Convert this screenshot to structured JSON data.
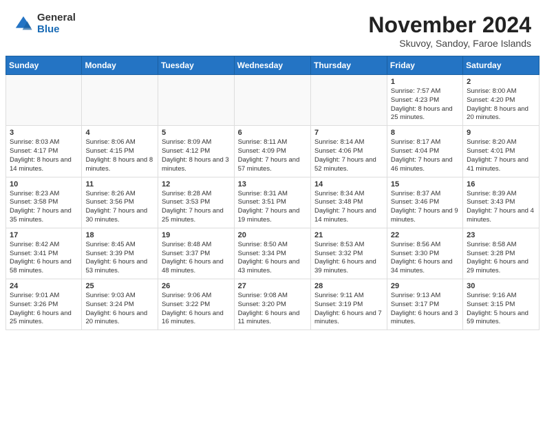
{
  "header": {
    "logo_general": "General",
    "logo_blue": "Blue",
    "month_title": "November 2024",
    "subtitle": "Skuvoy, Sandoy, Faroe Islands"
  },
  "weekdays": [
    "Sunday",
    "Monday",
    "Tuesday",
    "Wednesday",
    "Thursday",
    "Friday",
    "Saturday"
  ],
  "weeks": [
    [
      {
        "day": "",
        "info": ""
      },
      {
        "day": "",
        "info": ""
      },
      {
        "day": "",
        "info": ""
      },
      {
        "day": "",
        "info": ""
      },
      {
        "day": "",
        "info": ""
      },
      {
        "day": "1",
        "info": "Sunrise: 7:57 AM\nSunset: 4:23 PM\nDaylight: 8 hours and 25 minutes."
      },
      {
        "day": "2",
        "info": "Sunrise: 8:00 AM\nSunset: 4:20 PM\nDaylight: 8 hours and 20 minutes."
      }
    ],
    [
      {
        "day": "3",
        "info": "Sunrise: 8:03 AM\nSunset: 4:17 PM\nDaylight: 8 hours and 14 minutes."
      },
      {
        "day": "4",
        "info": "Sunrise: 8:06 AM\nSunset: 4:15 PM\nDaylight: 8 hours and 8 minutes."
      },
      {
        "day": "5",
        "info": "Sunrise: 8:09 AM\nSunset: 4:12 PM\nDaylight: 8 hours and 3 minutes."
      },
      {
        "day": "6",
        "info": "Sunrise: 8:11 AM\nSunset: 4:09 PM\nDaylight: 7 hours and 57 minutes."
      },
      {
        "day": "7",
        "info": "Sunrise: 8:14 AM\nSunset: 4:06 PM\nDaylight: 7 hours and 52 minutes."
      },
      {
        "day": "8",
        "info": "Sunrise: 8:17 AM\nSunset: 4:04 PM\nDaylight: 7 hours and 46 minutes."
      },
      {
        "day": "9",
        "info": "Sunrise: 8:20 AM\nSunset: 4:01 PM\nDaylight: 7 hours and 41 minutes."
      }
    ],
    [
      {
        "day": "10",
        "info": "Sunrise: 8:23 AM\nSunset: 3:58 PM\nDaylight: 7 hours and 35 minutes."
      },
      {
        "day": "11",
        "info": "Sunrise: 8:26 AM\nSunset: 3:56 PM\nDaylight: 7 hours and 30 minutes."
      },
      {
        "day": "12",
        "info": "Sunrise: 8:28 AM\nSunset: 3:53 PM\nDaylight: 7 hours and 25 minutes."
      },
      {
        "day": "13",
        "info": "Sunrise: 8:31 AM\nSunset: 3:51 PM\nDaylight: 7 hours and 19 minutes."
      },
      {
        "day": "14",
        "info": "Sunrise: 8:34 AM\nSunset: 3:48 PM\nDaylight: 7 hours and 14 minutes."
      },
      {
        "day": "15",
        "info": "Sunrise: 8:37 AM\nSunset: 3:46 PM\nDaylight: 7 hours and 9 minutes."
      },
      {
        "day": "16",
        "info": "Sunrise: 8:39 AM\nSunset: 3:43 PM\nDaylight: 7 hours and 4 minutes."
      }
    ],
    [
      {
        "day": "17",
        "info": "Sunrise: 8:42 AM\nSunset: 3:41 PM\nDaylight: 6 hours and 58 minutes."
      },
      {
        "day": "18",
        "info": "Sunrise: 8:45 AM\nSunset: 3:39 PM\nDaylight: 6 hours and 53 minutes."
      },
      {
        "day": "19",
        "info": "Sunrise: 8:48 AM\nSunset: 3:37 PM\nDaylight: 6 hours and 48 minutes."
      },
      {
        "day": "20",
        "info": "Sunrise: 8:50 AM\nSunset: 3:34 PM\nDaylight: 6 hours and 43 minutes."
      },
      {
        "day": "21",
        "info": "Sunrise: 8:53 AM\nSunset: 3:32 PM\nDaylight: 6 hours and 39 minutes."
      },
      {
        "day": "22",
        "info": "Sunrise: 8:56 AM\nSunset: 3:30 PM\nDaylight: 6 hours and 34 minutes."
      },
      {
        "day": "23",
        "info": "Sunrise: 8:58 AM\nSunset: 3:28 PM\nDaylight: 6 hours and 29 minutes."
      }
    ],
    [
      {
        "day": "24",
        "info": "Sunrise: 9:01 AM\nSunset: 3:26 PM\nDaylight: 6 hours and 25 minutes."
      },
      {
        "day": "25",
        "info": "Sunrise: 9:03 AM\nSunset: 3:24 PM\nDaylight: 6 hours and 20 minutes."
      },
      {
        "day": "26",
        "info": "Sunrise: 9:06 AM\nSunset: 3:22 PM\nDaylight: 6 hours and 16 minutes."
      },
      {
        "day": "27",
        "info": "Sunrise: 9:08 AM\nSunset: 3:20 PM\nDaylight: 6 hours and 11 minutes."
      },
      {
        "day": "28",
        "info": "Sunrise: 9:11 AM\nSunset: 3:19 PM\nDaylight: 6 hours and 7 minutes."
      },
      {
        "day": "29",
        "info": "Sunrise: 9:13 AM\nSunset: 3:17 PM\nDaylight: 6 hours and 3 minutes."
      },
      {
        "day": "30",
        "info": "Sunrise: 9:16 AM\nSunset: 3:15 PM\nDaylight: 5 hours and 59 minutes."
      }
    ]
  ]
}
